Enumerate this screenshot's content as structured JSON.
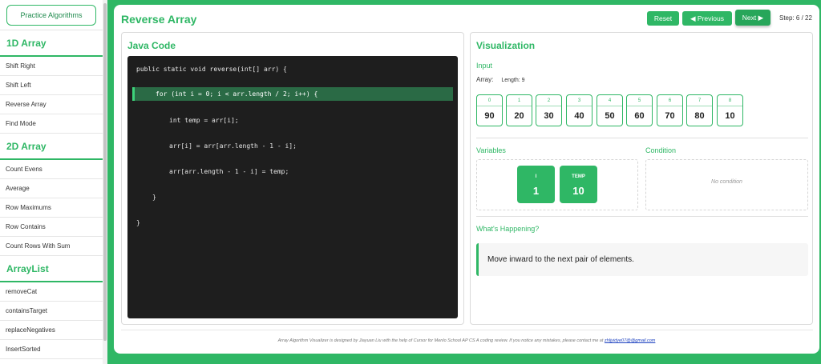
{
  "sidebar": {
    "practice_label": "Practice Algorithms",
    "sections": [
      {
        "title": "1D Array",
        "items": [
          "Shift Right",
          "Shift Left",
          "Reverse Array",
          "Find Mode"
        ]
      },
      {
        "title": "2D Array",
        "items": [
          "Count Evens",
          "Average",
          "Row Maximums",
          "Row Contains",
          "Count Rows With Sum"
        ]
      },
      {
        "title": "ArrayList",
        "items": [
          "removeCat",
          "containsTarget",
          "replaceNegatives",
          "InsertSorted"
        ]
      }
    ]
  },
  "header": {
    "title": "Reverse Array",
    "reset_label": "Reset",
    "prev_label": "◀ Previous",
    "next_label": "Next ▶",
    "step_text": "Step: 6 / 22"
  },
  "code": {
    "title": "Java Code",
    "lines": [
      "public static void reverse(int[] arr) {",
      "for (int i = 0; i < arr.length / 2; i++) {",
      "int temp = arr[i];",
      "arr[i] = arr[arr.length - 1 - i];",
      "arr[arr.length - 1 - i] = temp;",
      "}",
      "}"
    ]
  },
  "viz": {
    "title": "Visualization",
    "input_label": "Input",
    "array_label": "Array:",
    "length_text": "Length: 9",
    "array": {
      "indices": [
        "0",
        "1",
        "2",
        "3",
        "4",
        "5",
        "6",
        "7",
        "8"
      ],
      "values": [
        "90",
        "20",
        "30",
        "40",
        "50",
        "60",
        "70",
        "80",
        "10"
      ]
    },
    "variables_label": "Variables",
    "variables": [
      {
        "name": "I",
        "value": "1"
      },
      {
        "name": "TEMP",
        "value": "10"
      }
    ],
    "condition_label": "Condition",
    "condition_text": "No condition",
    "happening_label": "What's Happening?",
    "explanation": "Move inward to the next pair of elements."
  },
  "footer": {
    "text": "Array Algorithm Visualizer is designed by Jiayuan Liu with the help of Cursor for Menlo School AP CS A coding review. If you notice any mistakes, please contact me at",
    "email": "zhljyidye07@@gmail.com"
  },
  "colors": {
    "accent": "#2fb765",
    "code_bg": "#1e1e1e",
    "highlight_line": "#2a6a45"
  }
}
